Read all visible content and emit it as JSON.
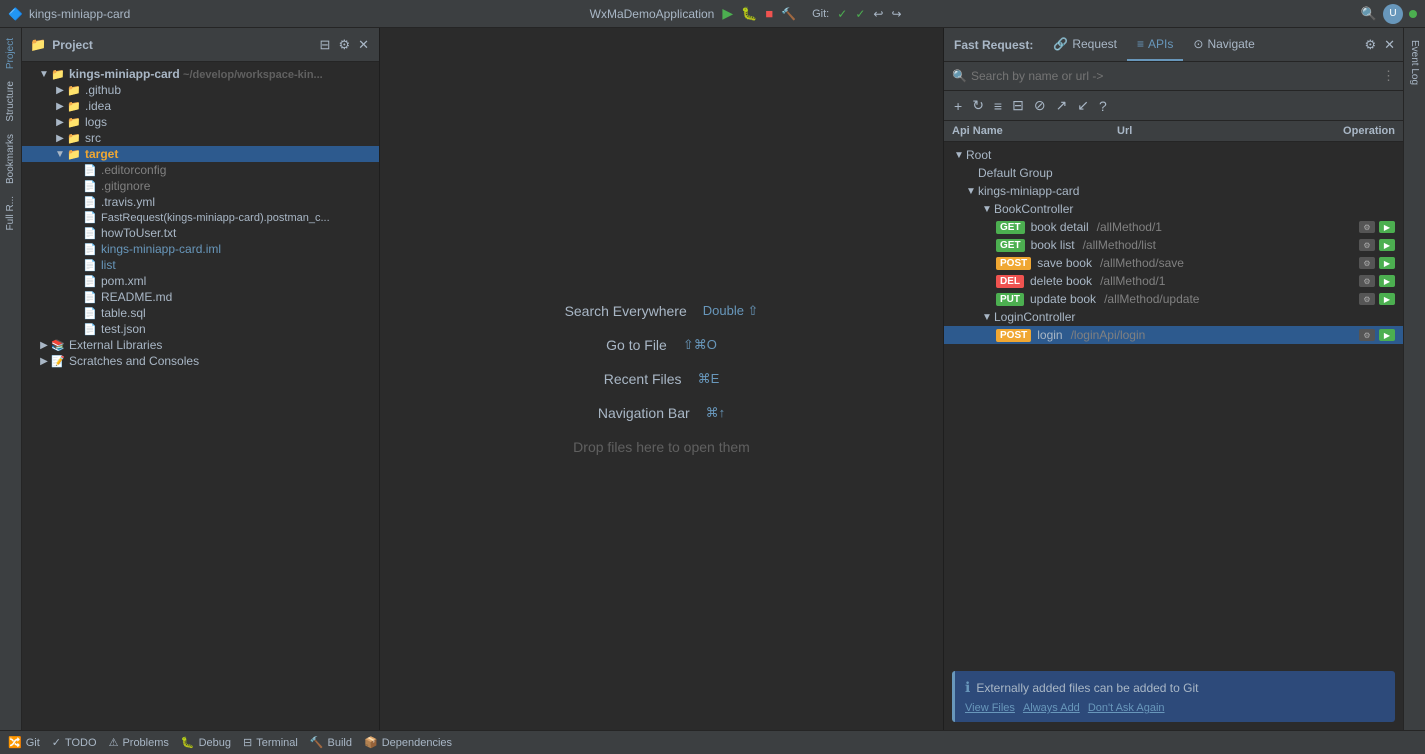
{
  "titlebar": {
    "app_name": "kings-miniapp-card",
    "app_config": "WxMaDemoApplication",
    "git_label": "Git:",
    "search_tooltip": "Search Everywhere"
  },
  "sidebar": {
    "tabs": [
      "Project",
      "Structure",
      "Bookmarks",
      "Full R..."
    ]
  },
  "file_tree": {
    "panel_title": "Project",
    "root_node": "kings-miniapp-card",
    "root_path": "~/develop/workspace-kin...",
    "items": [
      {
        "id": "github",
        "label": ".github",
        "type": "folder",
        "depth": 1,
        "expanded": false
      },
      {
        "id": "idea",
        "label": ".idea",
        "type": "folder",
        "depth": 1,
        "expanded": false
      },
      {
        "id": "logs",
        "label": "logs",
        "type": "folder",
        "depth": 1,
        "expanded": false
      },
      {
        "id": "src",
        "label": "src",
        "type": "folder",
        "depth": 1,
        "expanded": false
      },
      {
        "id": "target",
        "label": "target",
        "type": "folder-orange",
        "depth": 1,
        "expanded": true,
        "selected": true
      },
      {
        "id": "editorconfig",
        "label": ".editorconfig",
        "type": "file-gray",
        "depth": 2
      },
      {
        "id": "gitignore",
        "label": ".gitignore",
        "type": "file-gray",
        "depth": 2
      },
      {
        "id": "travis",
        "label": ".travis.yml",
        "type": "file-orange",
        "depth": 2
      },
      {
        "id": "fastRequest",
        "label": "FastRequest(kings-miniapp-card).postman_c...",
        "type": "file-orange",
        "depth": 2
      },
      {
        "id": "howToUser",
        "label": "howToUser.txt",
        "type": "file-gray",
        "depth": 2
      },
      {
        "id": "iml",
        "label": "kings-miniapp-card.iml",
        "type": "file-blue",
        "depth": 2
      },
      {
        "id": "list",
        "label": "list",
        "type": "file-blue",
        "depth": 2
      },
      {
        "id": "pom",
        "label": "pom.xml",
        "type": "file-orange",
        "depth": 2
      },
      {
        "id": "readme",
        "label": "README.md",
        "type": "file-gray",
        "depth": 2
      },
      {
        "id": "tablesql",
        "label": "table.sql",
        "type": "file-orange",
        "depth": 2
      },
      {
        "id": "testjson",
        "label": "test.json",
        "type": "file-orange",
        "depth": 2
      },
      {
        "id": "external",
        "label": "External Libraries",
        "type": "folder-lib",
        "depth": 0,
        "expanded": false
      },
      {
        "id": "scratches",
        "label": "Scratches and Consoles",
        "type": "folder-scratch",
        "depth": 0,
        "expanded": false
      }
    ]
  },
  "center_panel": {
    "search_everywhere_label": "Search Everywhere",
    "search_shortcut": "Double ⇧",
    "goto_file_label": "Go to File",
    "goto_shortcut": "⇧⌘O",
    "recent_files_label": "Recent Files",
    "recent_shortcut": "⌘E",
    "nav_bar_label": "Navigation Bar",
    "nav_shortcut": "⌘↑",
    "drop_label": "Drop files here to open them"
  },
  "fast_request": {
    "title": "Fast Request:",
    "tabs": [
      {
        "id": "request",
        "label": "Request",
        "icon": "🔗",
        "active": false
      },
      {
        "id": "apis",
        "label": "APIs",
        "icon": "≡",
        "active": true
      },
      {
        "id": "navigate",
        "label": "Navigate",
        "icon": "⊙",
        "active": false
      }
    ],
    "search_placeholder": "Search by name or url ->",
    "toolbar": {
      "add": "+",
      "refresh": "↻",
      "layout": "≡",
      "layout2": "⊟",
      "cancel": "⊘",
      "link": "↗",
      "export": "↙",
      "help": "?"
    },
    "columns": {
      "api_name": "Api Name",
      "url": "Url",
      "operation": "Operation"
    },
    "tree": {
      "root": "Root",
      "groups": [
        {
          "id": "default_group",
          "label": "Default Group",
          "depth": 1
        },
        {
          "id": "kings_miniapp",
          "label": "kings-miniapp-card",
          "depth": 1,
          "expanded": true,
          "controllers": [
            {
              "id": "book_controller",
              "label": "BookController",
              "depth": 2,
              "expanded": true,
              "endpoints": [
                {
                  "id": "book_detail",
                  "method": "GET",
                  "label": "book detail",
                  "url": "/allMethod/1"
                },
                {
                  "id": "book_list",
                  "method": "GET",
                  "label": "book list",
                  "url": "/allMethod/list"
                },
                {
                  "id": "save_book",
                  "method": "POST",
                  "label": "save book",
                  "url": "/allMethod/save"
                },
                {
                  "id": "delete_book",
                  "method": "DEL",
                  "label": "delete book",
                  "url": "/allMethod/1"
                },
                {
                  "id": "update_book",
                  "method": "PUT",
                  "label": "update book",
                  "url": "/allMethod/update"
                }
              ]
            },
            {
              "id": "login_controller",
              "label": "LoginController",
              "depth": 2,
              "expanded": true,
              "endpoints": [
                {
                  "id": "login",
                  "method": "POST",
                  "label": "login",
                  "url": "/loginApi/login",
                  "selected": true
                }
              ]
            }
          ]
        }
      ]
    },
    "notification": {
      "text": "Externally added files can be added to Git",
      "actions": [
        "View Files",
        "Always Add",
        "Don't Ask Again"
      ]
    }
  },
  "bottom_bar": {
    "items": [
      "🔀 Git",
      "✓ TODO",
      "⚠ Problems",
      "🐛 Debug",
      "⊟ Terminal",
      "🔨 Build",
      "📦 Dependencies"
    ]
  },
  "right_sidebar": {
    "tabs": [
      "Event Log"
    ]
  }
}
